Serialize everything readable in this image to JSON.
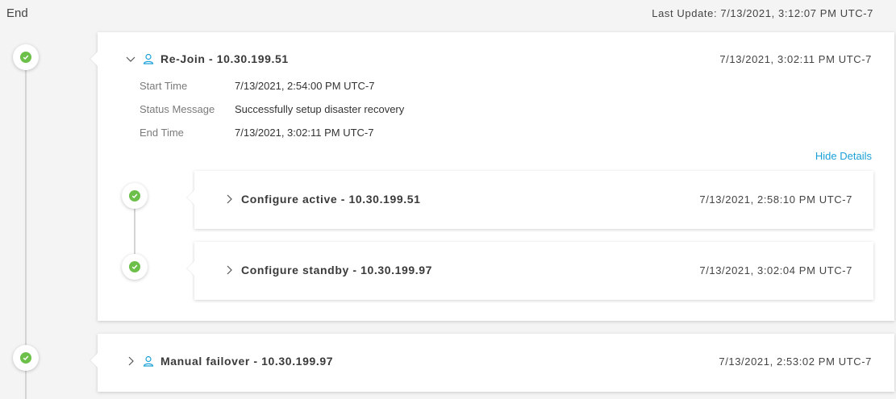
{
  "header": {
    "end_label": "End",
    "last_update": "Last Update: 7/13/2021, 3:12:07 PM UTC-7"
  },
  "events": [
    {
      "title": "Re-Join - 10.30.199.51",
      "timestamp": "7/13/2021, 3:02:11 PM UTC-7",
      "status": "success",
      "expanded": true,
      "icon": "user-icon",
      "details": [
        {
          "label": "Start Time",
          "value": "7/13/2021, 2:54:00 PM UTC-7"
        },
        {
          "label": "Status Message",
          "value": "Successfully setup disaster recovery"
        },
        {
          "label": "End Time",
          "value": "7/13/2021, 3:02:11 PM UTC-7"
        }
      ],
      "toggle_label": "Hide Details",
      "substeps": [
        {
          "title": "Configure active - 10.30.199.51",
          "timestamp": "7/13/2021, 2:58:10 PM UTC-7",
          "status": "success"
        },
        {
          "title": "Configure standby - 10.30.199.97",
          "timestamp": "7/13/2021, 3:02:04 PM UTC-7",
          "status": "success"
        }
      ]
    },
    {
      "title": "Manual failover - 10.30.199.97",
      "timestamp": "7/13/2021, 2:53:02 PM UTC-7",
      "status": "success",
      "expanded": false,
      "icon": "user-icon"
    }
  ],
  "colors": {
    "success": "#6cc04a",
    "link": "#1ba0d7",
    "user_icon": "#1ba0d7"
  }
}
